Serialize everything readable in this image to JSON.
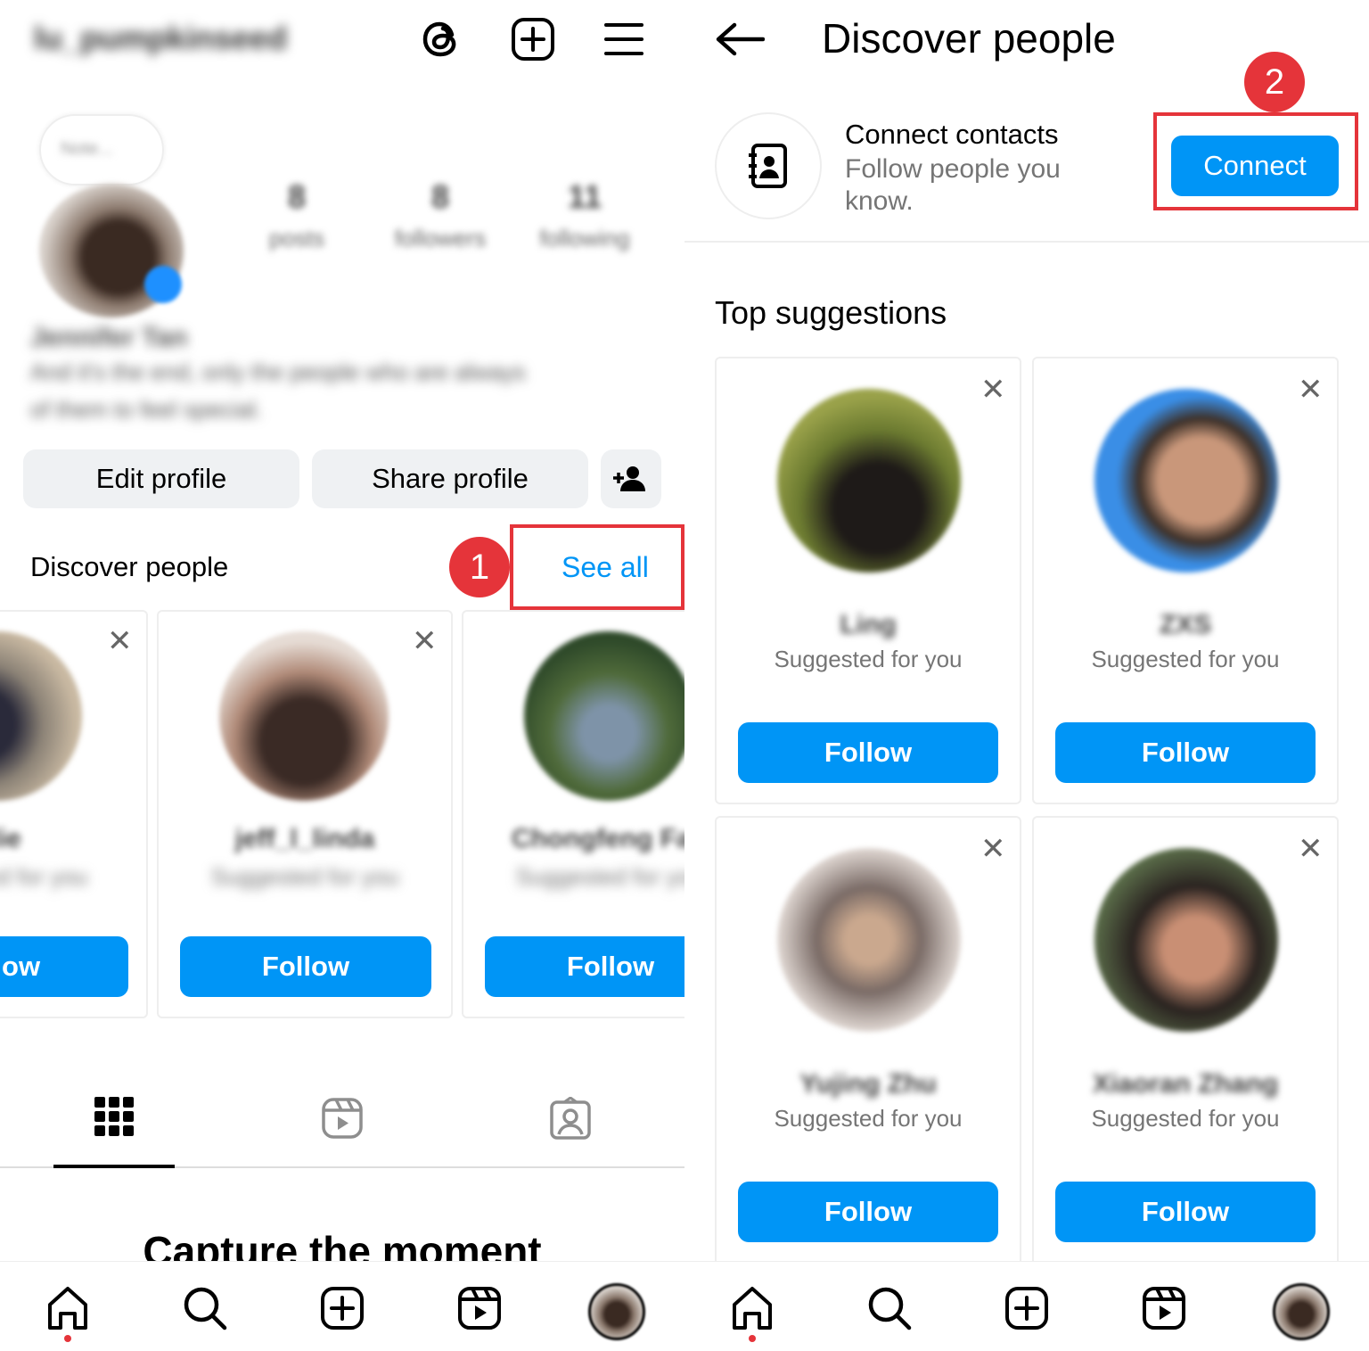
{
  "left": {
    "header": {
      "username": "lu_pumpkinseed"
    },
    "profile": {
      "note": "Note...",
      "stats": [
        {
          "value": "8",
          "label": "posts"
        },
        {
          "value": "8",
          "label": "followers"
        },
        {
          "value": "11",
          "label": "following"
        }
      ],
      "name": "Jennifer Tan",
      "bio_lines": [
        "And it's the end, only the people who are always",
        "of them to feel special."
      ]
    },
    "actions": {
      "edit_profile": "Edit profile",
      "share_profile": "Share profile"
    },
    "discover": {
      "title": "Discover people",
      "see_all": "See all",
      "step_number": "1",
      "cards": [
        {
          "name": "Ellie",
          "sub": "Suggested for you",
          "follow": "Follow"
        },
        {
          "name": "jeff_l_linda",
          "sub": "Suggested for you",
          "follow": "Follow"
        },
        {
          "name": "Chongfeng Fan",
          "sub": "Suggested for you",
          "follow": "Follow"
        }
      ]
    },
    "empty_state": {
      "title": "Capture the moment"
    }
  },
  "right": {
    "title": "Discover people",
    "connect_contacts": {
      "title": "Connect contacts",
      "subtitle": "Follow people you know.",
      "button": "Connect",
      "step_number": "2"
    },
    "section_title": "Top suggestions",
    "suggestions": [
      {
        "name": "Ling",
        "sub": "Suggested for you",
        "follow": "Follow"
      },
      {
        "name": "ZXS",
        "sub": "Suggested for you",
        "follow": "Follow"
      },
      {
        "name": "Yujing Zhu",
        "sub": "Suggested for you",
        "follow": "Follow"
      },
      {
        "name": "Xiaoran Zhang",
        "sub": "Suggested for you",
        "follow": "Follow"
      }
    ]
  },
  "colors": {
    "primary": "#0095f6",
    "highlight": "#e5343a",
    "button_gray": "#eff1f3"
  }
}
